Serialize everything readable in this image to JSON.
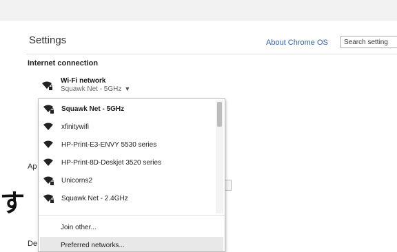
{
  "header": {
    "title": "Settings",
    "about_link": "About Chrome OS",
    "search_value": "Search setting"
  },
  "section": {
    "title": "Internet connection"
  },
  "wifi": {
    "label": "Wi-Fi network",
    "current": "Squawk Net - 5GHz",
    "icon": "wifi-locked-icon"
  },
  "background": {
    "ap_fragment": "Ap",
    "de_fragment": "De",
    "button_fragment": "e",
    "japanese_glyph": "す"
  },
  "menu": {
    "networks": [
      {
        "label": "Squawk Net - 5GHz",
        "secured": true,
        "selected": true
      },
      {
        "label": "xfinitywifi",
        "secured": false,
        "selected": false
      },
      {
        "label": "HP-Print-E3-ENVY 5530 series",
        "secured": false,
        "selected": false
      },
      {
        "label": "HP-Print-8D-Deskjet 3520 series",
        "secured": false,
        "selected": false
      },
      {
        "label": "Unicorns2",
        "secured": true,
        "selected": false
      },
      {
        "label": "Squawk Net - 2.4GHz",
        "secured": true,
        "selected": false
      }
    ],
    "join_other": "Join other...",
    "preferred_networks": "Preferred networks..."
  }
}
